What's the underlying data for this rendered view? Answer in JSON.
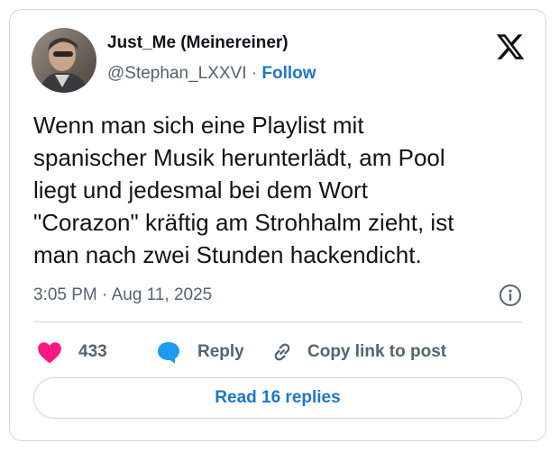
{
  "author": {
    "display_name": "Just_Me (Meinereiner)",
    "handle": "@Stephan_LXXVI",
    "separator": " · ",
    "follow_label": "Follow"
  },
  "tweet": {
    "lines": [
      "Wenn man sich eine Playlist mit",
      "spanischer Musik herunterlädt, am Pool",
      "liegt und jedesmal bei dem Wort",
      "\"Corazon\" kräftig am Strohhalm zieht, ist",
      "man nach zwei Stunden hackendicht."
    ],
    "timestamp": "3:05 PM · Aug 11, 2025"
  },
  "actions": {
    "like_count": "433",
    "reply_label": "Reply",
    "copy_link_label": "Copy link to post"
  },
  "read_replies_label": "Read 16 replies",
  "icons": {
    "logo": "x-logo-icon",
    "info": "info-icon",
    "like": "heart-icon",
    "reply": "speech-bubble-icon",
    "copy": "link-icon"
  },
  "colors": {
    "link_blue": "#1d77c9",
    "heart_pink": "#f91880",
    "reply_blue": "#1d9bf0",
    "text_primary": "#0f1419",
    "text_secondary": "#536471",
    "border": "#cfd9de"
  }
}
